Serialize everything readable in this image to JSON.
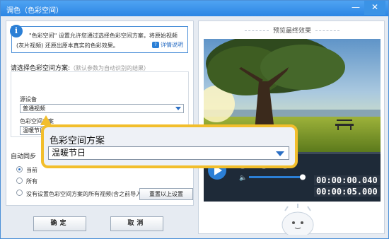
{
  "window": {
    "title": "调色（色彩空间）",
    "min_glyph": "—",
    "close_glyph": "✕"
  },
  "info": {
    "badge": "i",
    "line1": "\"色彩空间\" 设置允许您通过选择色彩空间方案，将原始视频",
    "line2": "(灰片视频) 还原出原本真实的色彩效果。",
    "detail_icon": "?",
    "detail_link": "详情说明"
  },
  "scheme": {
    "label": "请选择色彩空间方案:",
    "hint": "（默认参数为自动识别的结果）",
    "source_label": "源设备",
    "source_value": "普通视频",
    "space_label": "色彩空间方案",
    "space_value": "温暖节日"
  },
  "sync": {
    "label": "自动同步",
    "options": [
      "当前",
      "所有",
      "没有设置色彩空间方案的所有视频(含之前导入过的所有视频)"
    ],
    "selected_index": 0
  },
  "reset_label": "重置以上设置",
  "ok_label": "确定",
  "cancel_label": "取消",
  "preview": {
    "title": "预览最终效果",
    "time_current": "00:00:00.040",
    "time_total": "00:00:05.000",
    "volume_icon": "🔈",
    "progress": 0.04
  },
  "callout": {
    "title": "色彩空间方案",
    "value": "温暖节日"
  },
  "colors": {
    "accent": "#2b7fd6",
    "highlight": "#f2be2c",
    "titlebar": "#3a92e8"
  }
}
